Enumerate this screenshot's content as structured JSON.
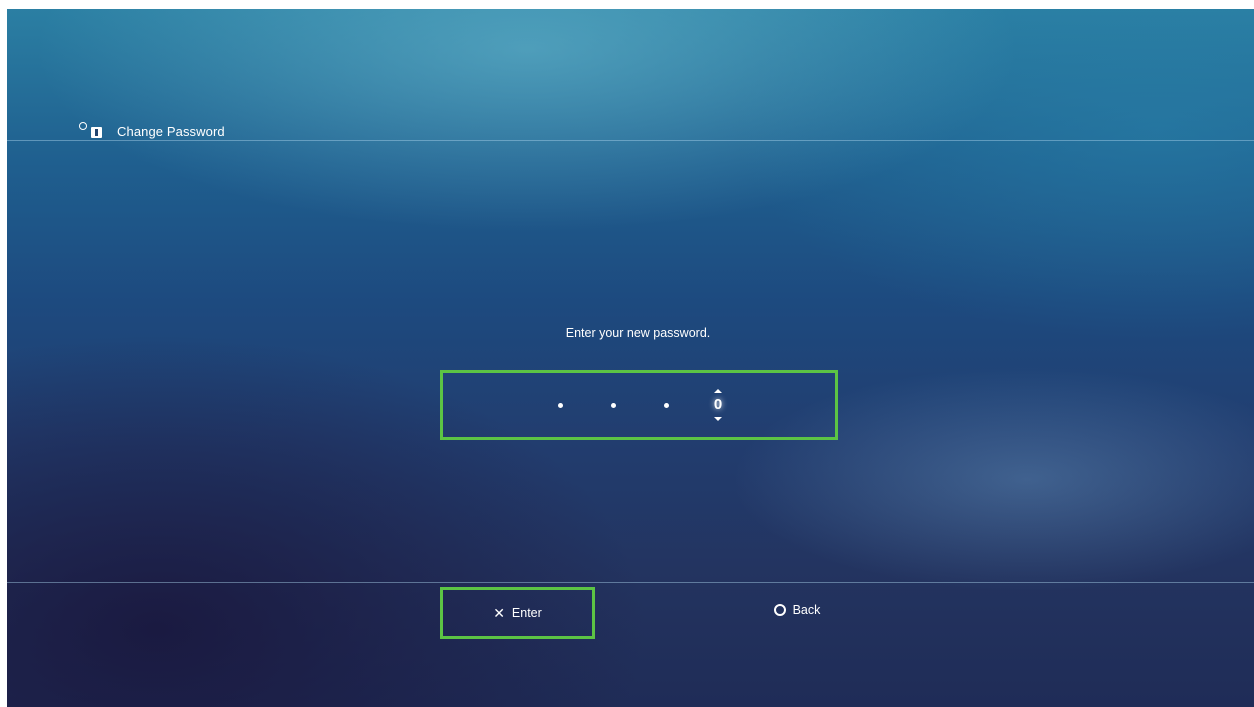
{
  "header": {
    "title": "Change Password",
    "icon": "parental-control-icon"
  },
  "dialog": {
    "prompt": "Enter your new password.",
    "password": {
      "masked_digits": [
        "•",
        "•",
        "•"
      ],
      "current_digit": "0"
    }
  },
  "footer": {
    "enter": {
      "glyph": "✕",
      "label": "Enter",
      "icon": "cross-button-icon"
    },
    "back": {
      "glyph": "○",
      "label": "Back",
      "icon": "circle-button-icon"
    }
  },
  "colors": {
    "highlight": "#5cc444",
    "background_top": "#2b7fa3",
    "background_bottom": "#1f2c57"
  }
}
